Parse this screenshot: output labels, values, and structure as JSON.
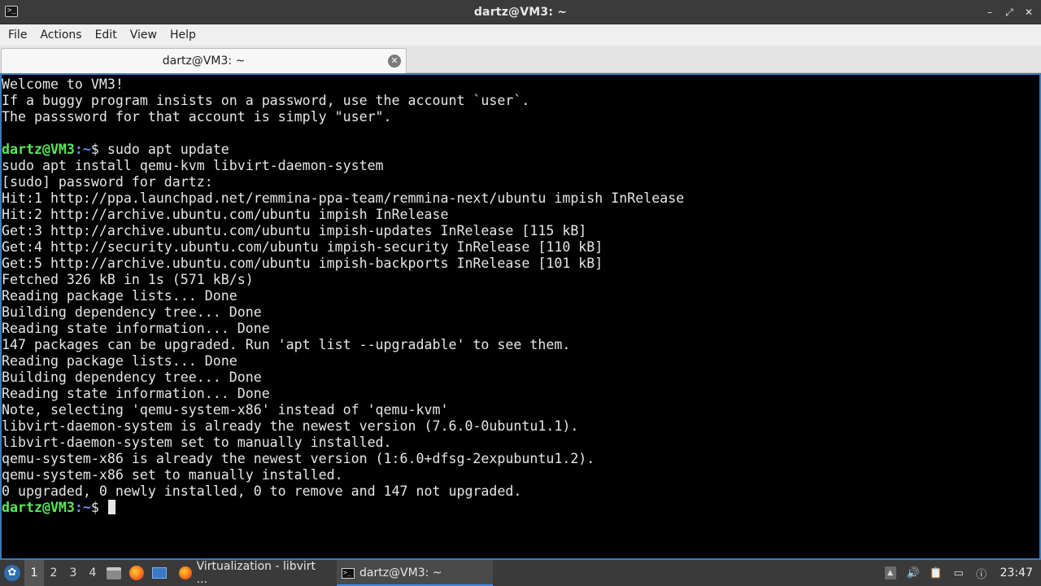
{
  "window": {
    "title": "dartz@VM3: ~",
    "app_icon_glyph": ">_",
    "controls": {
      "minimize": "–",
      "maximize": "⤢",
      "close": "✕"
    }
  },
  "menu": [
    "File",
    "Actions",
    "Edit",
    "View",
    "Help"
  ],
  "tab": {
    "label": "dartz@VM3: ~",
    "close_glyph": "✕"
  },
  "terminal": {
    "prompt_user": "dartz@VM3",
    "prompt_path": ":~",
    "prompt_suffix": "$ ",
    "lines": [
      {
        "text": "Welcome to VM3!"
      },
      {
        "text": "If a buggy program insists on a password, use the account `user`."
      },
      {
        "text": "The passsword for that account is simply \"user\"."
      },
      {
        "text": ""
      },
      {
        "prompt": true,
        "text": "sudo apt update"
      },
      {
        "text": "sudo apt install qemu-kvm libvirt-daemon-system"
      },
      {
        "text": "[sudo] password for dartz:"
      },
      {
        "text": "Hit:1 http://ppa.launchpad.net/remmina-ppa-team/remmina-next/ubuntu impish InRelease"
      },
      {
        "text": "Hit:2 http://archive.ubuntu.com/ubuntu impish InRelease"
      },
      {
        "text": "Get:3 http://archive.ubuntu.com/ubuntu impish-updates InRelease [115 kB]"
      },
      {
        "text": "Get:4 http://security.ubuntu.com/ubuntu impish-security InRelease [110 kB]"
      },
      {
        "text": "Get:5 http://archive.ubuntu.com/ubuntu impish-backports InRelease [101 kB]"
      },
      {
        "text": "Fetched 326 kB in 1s (571 kB/s)"
      },
      {
        "text": "Reading package lists... Done"
      },
      {
        "text": "Building dependency tree... Done"
      },
      {
        "text": "Reading state information... Done"
      },
      {
        "text": "147 packages can be upgraded. Run 'apt list --upgradable' to see them."
      },
      {
        "text": "Reading package lists... Done"
      },
      {
        "text": "Building dependency tree... Done"
      },
      {
        "text": "Reading state information... Done"
      },
      {
        "text": "Note, selecting 'qemu-system-x86' instead of 'qemu-kvm'"
      },
      {
        "text": "libvirt-daemon-system is already the newest version (7.6.0-0ubuntu1.1)."
      },
      {
        "text": "libvirt-daemon-system set to manually installed."
      },
      {
        "text": "qemu-system-x86 is already the newest version (1:6.0+dfsg-2expubuntu1.2)."
      },
      {
        "text": "qemu-system-x86 set to manually installed."
      },
      {
        "text": "0 upgraded, 0 newly installed, 0 to remove and 147 not upgraded."
      },
      {
        "prompt": true,
        "text": "",
        "cursor": true
      }
    ]
  },
  "taskbar": {
    "start_glyph": "✿",
    "desktops": [
      "1",
      "2",
      "3",
      "4"
    ],
    "active_desktop": "1",
    "quicklaunch": [
      "file-manager-icon",
      "firefox-icon",
      "show-desktop-icon"
    ],
    "tasks": [
      {
        "label": "Virtualization - libvirt ...",
        "icon": "firefox-icon",
        "active": false
      },
      {
        "label": "dartz@VM3: ~",
        "icon": "terminal-icon",
        "active": true
      }
    ],
    "tray": [
      "tray-expand-icon",
      "volume-icon",
      "clipboard-icon",
      "network-icon",
      "notifications-icon"
    ],
    "clock": "23:47"
  },
  "colors": {
    "terminal_bg": "#000000",
    "terminal_fg": "#e6e6e6",
    "prompt_user": "#5ae85a",
    "prompt_path": "#6a8cff",
    "focus_border": "#3d7bb8"
  }
}
